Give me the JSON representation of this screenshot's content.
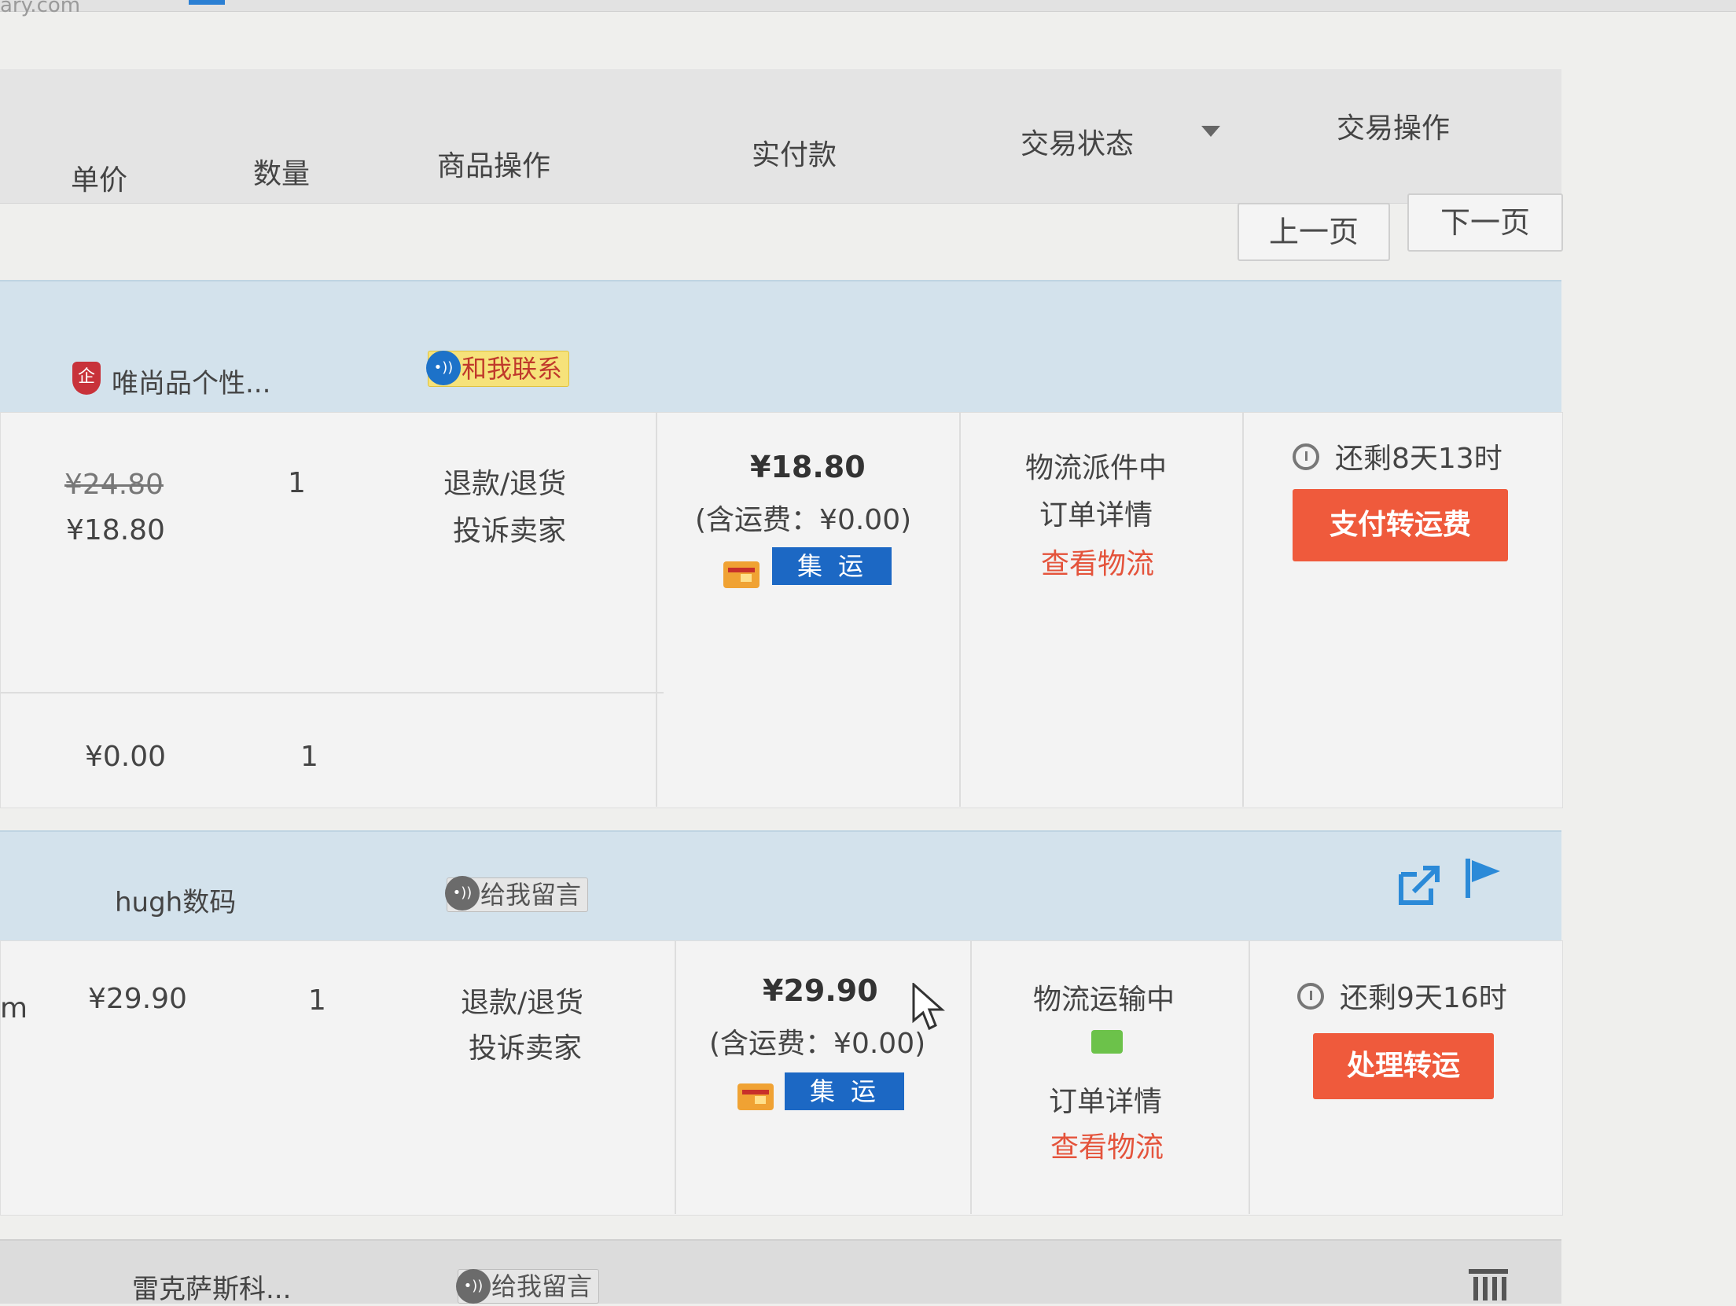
{
  "browser": {
    "url_fragment": "ary.com"
  },
  "table_header": {
    "columns": [
      "单价",
      "数量",
      "商品操作",
      "实付款",
      "交易状态",
      "交易操作"
    ]
  },
  "pager": {
    "prev": "上一页",
    "next": "下一页"
  },
  "orders": [
    {
      "shop_badge": "企",
      "shop_name": "唯尚品个性...",
      "contact": "和我联系",
      "items": [
        {
          "original_price": "¥24.80",
          "price": "¥18.80",
          "qty": "1",
          "ops": [
            "退款/退货",
            "投诉卖家"
          ]
        },
        {
          "price": "¥0.00",
          "qty": "1"
        }
      ],
      "paid": "¥18.80",
      "shipping": "(含运费：¥0.00)",
      "consolidated": "集运",
      "status": "物流派件中",
      "detail": "订单详情",
      "logistics": "查看物流",
      "remaining": "还剩8天13时",
      "action": "支付转运费"
    },
    {
      "shop_name": "hugh数码",
      "contact": "给我留言",
      "item_title_fragment": "m",
      "items": [
        {
          "price": "¥29.90",
          "qty": "1",
          "ops": [
            "退款/退货",
            "投诉卖家"
          ]
        }
      ],
      "paid": "¥29.90",
      "shipping": "(含运费：¥0.00)",
      "consolidated": "集运",
      "status": "物流运输中",
      "detail": "订单详情",
      "logistics": "查看物流",
      "remaining": "还剩9天16时",
      "action": "处理转运"
    },
    {
      "shop_name": "雷克萨斯科...",
      "contact": "给我留言"
    }
  ],
  "icons": {
    "shield": "shield-icon",
    "chat_bubble": "chat-bubble-icon",
    "wallet": "wallet-icon",
    "clock": "clock-icon",
    "share": "share-icon",
    "flag": "flag-icon",
    "trash": "trash-icon",
    "message": "message-icon",
    "dropdown": "dropdown-arrow-icon",
    "cursor": "mouse-cursor-icon"
  },
  "colors": {
    "action_red": "#ef5a3c",
    "link_red": "#e4533b",
    "jiyun_blue": "#1c68c4",
    "order_header_blue": "#d3e2ec"
  }
}
